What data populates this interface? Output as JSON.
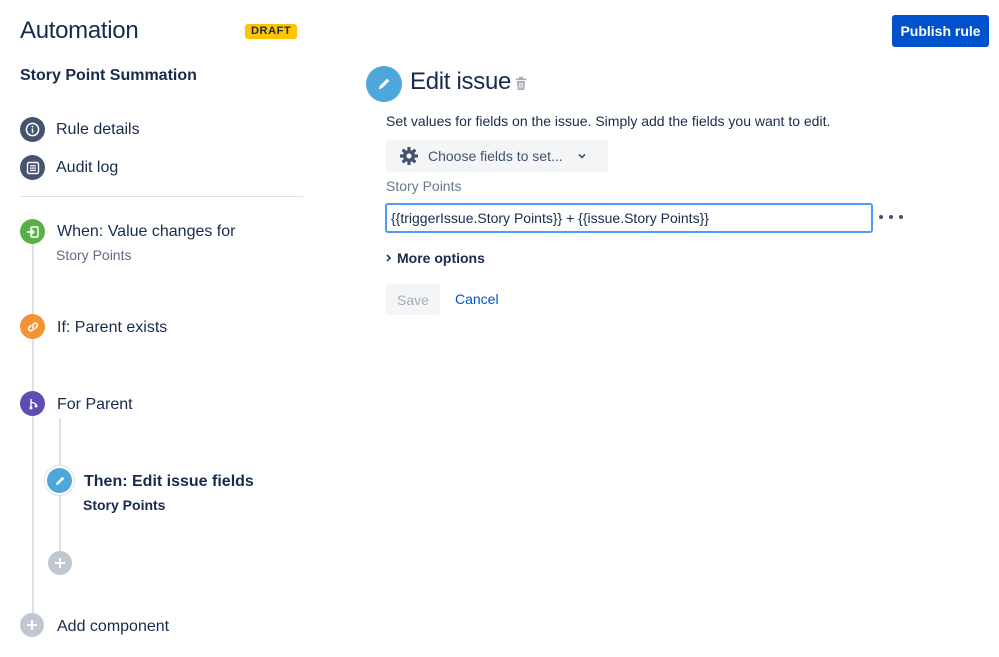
{
  "header": {
    "title": "Automation",
    "badge": "DRAFT",
    "publish_label": "Publish rule"
  },
  "sidebar": {
    "rule_name": "Story Point Summation",
    "nav": [
      {
        "label": "Rule details",
        "icon": "info-icon"
      },
      {
        "label": "Audit log",
        "icon": "list-icon"
      }
    ],
    "steps": {
      "trigger": {
        "label": "When: Value changes for",
        "sub": "Story Points",
        "icon": "trigger-icon"
      },
      "condition": {
        "label": "If: Parent exists",
        "icon": "link-icon"
      },
      "branch": {
        "label": "For Parent",
        "icon": "branch-icon"
      },
      "action": {
        "label": "Then: Edit issue fields",
        "sub": "Story Points",
        "icon": "pencil-icon"
      },
      "add_component": {
        "label": "Add component",
        "icon": "plus-icon"
      }
    }
  },
  "main": {
    "title": "Edit issue",
    "description": "Set values for fields on the issue. Simply add the fields you want to edit.",
    "choose_fields_label": "Choose fields to set...",
    "field": {
      "label": "Story Points",
      "value": "{{triggerIssue.Story Points}} + {{issue.Story Points}}"
    },
    "more_options_label": "More options",
    "save_label": "Save",
    "cancel_label": "Cancel"
  },
  "colors": {
    "primary": "#0052CC",
    "draft": "#FFC400",
    "trigger": "#5BAF49",
    "condition": "#F49333",
    "branch": "#5E4DB2",
    "action": "#4EA6DB",
    "nav_icon": "#44546F"
  }
}
